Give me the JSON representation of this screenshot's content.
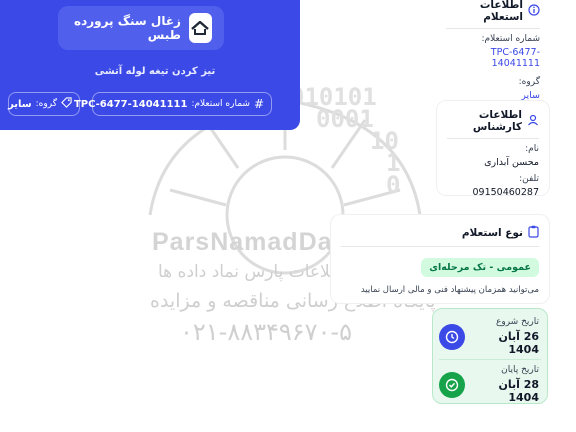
{
  "hero": {
    "title": "زغال سنگ پرورده طبس",
    "subtitle": "تیز کردن تیغه لوله آتشی",
    "number_label": "شماره استعلام:",
    "number_value": "TPC-6477-14041111",
    "group_label": "گروه:",
    "group_value": "سایر"
  },
  "inquiry_info": {
    "title": "اطلاعات استعلام",
    "number_label": "شماره استعلام:",
    "number_value": "TPC-6477-14041111",
    "group_label": "گروه:",
    "group_value": "سایر"
  },
  "expert_info": {
    "title": "اطلاعات کارشناس",
    "name_label": "نام:",
    "name_value": "محسن آبداری",
    "phone_label": "تلفن:",
    "phone_value": "09150460287"
  },
  "inquiry_type": {
    "title": "نوع استعلام",
    "tag": "عمومی - تک مرحله‌ای",
    "note": "می‌توانید همزمان پیشنهاد فنی و مالی ارسال نمایید"
  },
  "dates": {
    "start_label": "تاریخ شروع",
    "start_value": "26 آبان 1404",
    "end_label": "تاریخ پایان",
    "end_value": "28 آبان 1404"
  },
  "watermark": {
    "brand": "ParsNamadData",
    "line1": "مرکز فن آوری اطلاعات پارس نماد داده ها",
    "line2": "پایگاه اطلاع رسانی مناقصه و مزایده",
    "phone": "۰۲۱-۸۸۳۴۹۶۷۰-۵",
    "binary": [
      "010101",
      "0001",
      "10",
      "1",
      "0"
    ]
  },
  "colors": {
    "primary": "#3b49e6",
    "success": "#16a34a",
    "success_bg": "#e9f8ef",
    "tag_bg": "#d1fadf",
    "tag_text": "#067647"
  }
}
